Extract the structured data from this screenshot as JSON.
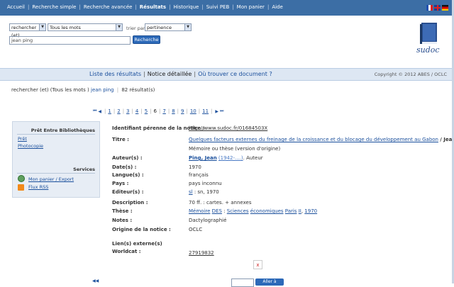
{
  "topnav": {
    "items": [
      {
        "label": "Accueil",
        "active": false
      },
      {
        "label": "Recherche simple",
        "active": false
      },
      {
        "label": "Recherche avancée",
        "active": false
      },
      {
        "label": "Résultats",
        "active": true
      },
      {
        "label": "Historique",
        "active": false
      },
      {
        "label": "Suivi PEB",
        "active": false
      },
      {
        "label": "Mon panier",
        "active": false
      },
      {
        "label": "Aide",
        "active": false
      }
    ],
    "separator": "|"
  },
  "search": {
    "operator": "rechercher (et)",
    "field": "Tous les mots",
    "sort_label": "trier par",
    "sort_value": "pertinence",
    "query": "jean ping",
    "button": "Recherche"
  },
  "logo": {
    "text": "sudoc"
  },
  "band": {
    "tabs": [
      {
        "label": "Liste des résultats",
        "current": false
      },
      {
        "label": "Notice détaillée",
        "current": true
      },
      {
        "label": "Où trouver ce document ?",
        "current": false
      }
    ],
    "sep": "|",
    "copyright": "Copyright © 2012 ABES / OCLC"
  },
  "criteria": {
    "prefix": "rechercher (et) (Tous les mots )",
    "term": "jean ping",
    "sep": "|",
    "count": "82 résultat(s)"
  },
  "pager": {
    "pages": [
      "1",
      "2",
      "3",
      "4",
      "5",
      "6",
      "7",
      "8",
      "9",
      "10",
      "11"
    ],
    "current": "6",
    "sep": "|"
  },
  "sidebar": {
    "peb_title": "Prêt Entre Bibliothèques",
    "peb_links": [
      "Prêt",
      "Photocopie"
    ],
    "services_title": "Services",
    "services_links": [
      "Mon panier / Export",
      "Flux RSS"
    ]
  },
  "record": {
    "id_label": "Identifiant pérenne de la notice :",
    "id_value": "http://www.sudoc.fr/01684503X",
    "title_label": "Titre :",
    "title_link": "Quelques facteurs externes du freinage de la croissance et du blocage du développement au Gabon",
    "title_rest": "/ Jean Ping",
    "title_line2": "Mémoire ou thèse (version d'origine)",
    "author_label": "Auteur(s) :",
    "author_name": "Ping, Jean",
    "author_dates": "(1942-....)",
    "author_role": ". Auteur",
    "date_label": "Date(s) :",
    "date_value": "1970",
    "lang_label": "Langue(s) :",
    "lang_value": "français",
    "country_label": "Pays :",
    "country_value": "pays inconnu",
    "publisher_label": "Editeur(s) :",
    "publisher_link": "sl",
    "publisher_rest": ": sn, 1970",
    "desc_label": "Description :",
    "desc_value": "70 ff. : cartes. + annexes",
    "thesis_label": "Thèse :",
    "thesis_parts": [
      {
        "text": "Mémoire",
        "link": true
      },
      {
        "text": " ",
        "link": false
      },
      {
        "text": "DES",
        "link": true
      },
      {
        "text": " : ",
        "link": false
      },
      {
        "text": "Sciences",
        "link": true
      },
      {
        "text": " ",
        "link": false
      },
      {
        "text": "économiques",
        "link": true
      },
      {
        "text": " ",
        "link": false
      },
      {
        "text": "Paris",
        "link": true
      },
      {
        "text": " ",
        "link": false
      },
      {
        "text": "II",
        "link": true
      },
      {
        "text": ", ",
        "link": false
      },
      {
        "text": "1970",
        "link": true
      }
    ],
    "notes_label": "Notes :",
    "notes_value": "Dactylographié",
    "origin_label": "Origine de la notice :",
    "origin_value": "OCLC",
    "ext_label": "Lien(s) externe(s)",
    "worldcat_label": "Worldcat :",
    "worldcat_value": "27919832"
  },
  "bottom": {
    "close": "x",
    "go": "Aller à"
  },
  "colors": {
    "nav_bg": "#3c6ea5",
    "band_bg": "#dde7f3",
    "link": "#1a4f9c",
    "panel_bg": "#e7edf5"
  }
}
